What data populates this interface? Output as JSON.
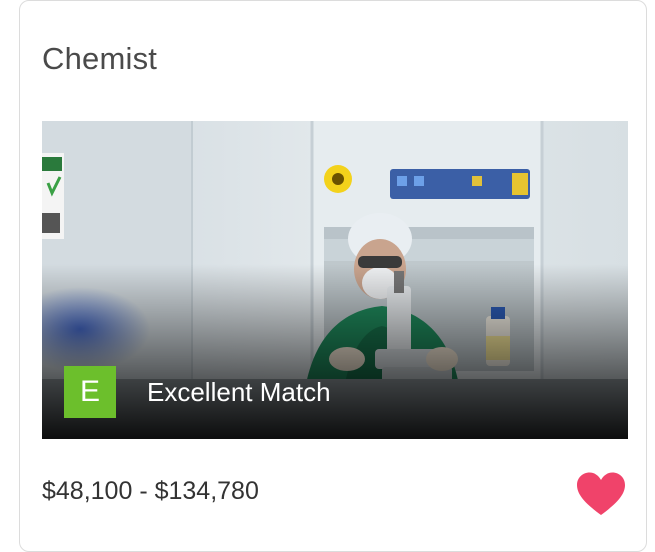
{
  "card": {
    "title": "Chemist",
    "image_alt": "Lab worker using microscope",
    "match": {
      "grade": "E",
      "label": "Excellent Match",
      "grade_color": "#6cbf2c"
    },
    "salary": "$48,100 - $134,780",
    "favorite": {
      "icon": "heart-icon",
      "active": true,
      "color": "#f0436a"
    }
  }
}
